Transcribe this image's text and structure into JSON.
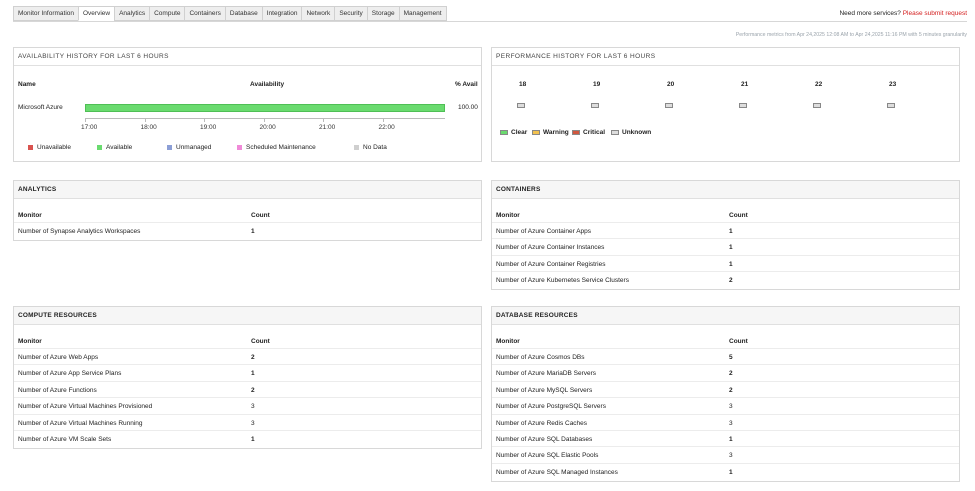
{
  "tabs": [
    "Monitor Information",
    "Overview",
    "Analytics",
    "Compute",
    "Containers",
    "Database",
    "Integration",
    "Network",
    "Security",
    "Storage",
    "Management"
  ],
  "active_tab": "Overview",
  "need_more": "Need more services?",
  "submit_request": "Please submit request",
  "perf_note": "Performance metrics from Apr 24,2025 12:08 AM to Apr 24,2025 11:16 PM with 5 minutes granularity",
  "availability": {
    "title": "AVAILABILITY HISTORY FOR LAST 6 HOURS",
    "col_name": "Name",
    "col_avail": "Availability",
    "col_pct": "% Avail",
    "row_name": "Microsoft Azure",
    "row_pct": "100.00",
    "available_fraction": 1.0,
    "ticks": [
      "17:00",
      "18:00",
      "19:00",
      "20:00",
      "21:00",
      "22:00"
    ],
    "legend": [
      {
        "label": "Unavailable",
        "color": "#d9534f"
      },
      {
        "label": "Available",
        "color": "#6adb6f"
      },
      {
        "label": "Unmanaged",
        "color": "#8c9fd6"
      },
      {
        "label": "Scheduled Maintenance",
        "color": "#f08ad8"
      },
      {
        "label": "No Data",
        "color": "#cfcfcf"
      }
    ]
  },
  "performance": {
    "title": "PERFORMANCE HISTORY FOR LAST 6 HOURS",
    "hours": [
      "18",
      "19",
      "20",
      "21",
      "22",
      "23"
    ],
    "legend": [
      {
        "label": "Clear",
        "color": "#6adb6f"
      },
      {
        "label": "Warning",
        "color": "#f3c24f"
      },
      {
        "label": "Critical",
        "color": "#d0573f"
      },
      {
        "label": "Unknown",
        "color": "#dddddd"
      }
    ]
  },
  "analytics": {
    "title": "ANALYTICS",
    "col_monitor": "Monitor",
    "col_count": "Count",
    "rows": [
      {
        "monitor": "Number of Synapse Analytics Workspaces",
        "count": "1"
      }
    ]
  },
  "containers": {
    "title": "CONTAINERS",
    "col_monitor": "Monitor",
    "col_count": "Count",
    "rows": [
      {
        "monitor": "Number of Azure Container Apps",
        "count": "1"
      },
      {
        "monitor": "Number of Azure Container Instances",
        "count": "1"
      },
      {
        "monitor": "Number of Azure Container Registries",
        "count": "1"
      },
      {
        "monitor": "Number of Azure Kubernetes Service Clusters",
        "count": "2"
      }
    ]
  },
  "compute": {
    "title": "COMPUTE RESOURCES",
    "col_monitor": "Monitor",
    "col_count": "Count",
    "rows": [
      {
        "monitor": "Number of Azure Web Apps",
        "count": "2"
      },
      {
        "monitor": "Number of Azure App Service Plans",
        "count": "1"
      },
      {
        "monitor": "Number of Azure Functions",
        "count": "2"
      },
      {
        "monitor": "Number of Azure Virtual Machines Provisioned",
        "count": "3"
      },
      {
        "monitor": "Number of Azure Virtual Machines Running",
        "count": "3"
      },
      {
        "monitor": "Number of Azure VM Scale Sets",
        "count": "1"
      }
    ]
  },
  "database": {
    "title": "DATABASE RESOURCES",
    "col_monitor": "Monitor",
    "col_count": "Count",
    "rows": [
      {
        "monitor": "Number of Azure Cosmos DBs",
        "count": "5"
      },
      {
        "monitor": "Number of Azure MariaDB Servers",
        "count": "2"
      },
      {
        "monitor": "Number of Azure MySQL Servers",
        "count": "2"
      },
      {
        "monitor": "Number of Azure PostgreSQL Servers",
        "count": "3"
      },
      {
        "monitor": "Number of Azure Redis Caches",
        "count": "3"
      },
      {
        "monitor": "Number of Azure SQL Databases",
        "count": "1"
      },
      {
        "monitor": "Number of Azure SQL Elastic Pools",
        "count": "3"
      },
      {
        "monitor": "Number of Azure SQL Managed Instances",
        "count": "1"
      }
    ]
  }
}
